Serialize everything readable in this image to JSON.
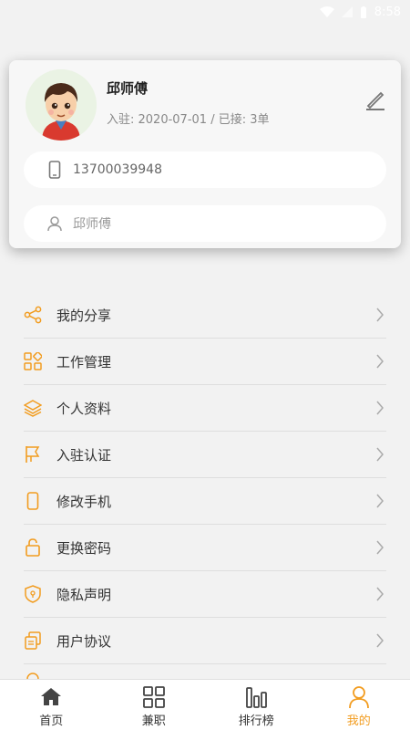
{
  "status_bar": {
    "time": "8:58"
  },
  "profile": {
    "name": "邱师傅",
    "meta": "入驻: 2020-07-01 / 已接: 3单",
    "phone": "13700039948",
    "name_field": "邱师傅"
  },
  "menu": {
    "items": [
      {
        "label": "我的分享",
        "icon": "share-icon"
      },
      {
        "label": "工作管理",
        "icon": "grid-icon"
      },
      {
        "label": "个人资料",
        "icon": "layers-icon"
      },
      {
        "label": "入驻认证",
        "icon": "flag-icon"
      },
      {
        "label": "修改手机",
        "icon": "mobile-icon"
      },
      {
        "label": "更换密码",
        "icon": "lock-icon"
      },
      {
        "label": "隐私声明",
        "icon": "shield-icon"
      },
      {
        "label": "用户协议",
        "icon": "document-icon"
      }
    ]
  },
  "tabbar": {
    "tabs": [
      {
        "label": "首页",
        "icon": "home-icon"
      },
      {
        "label": "兼职",
        "icon": "apps-icon"
      },
      {
        "label": "排行榜",
        "icon": "bar-chart-icon"
      },
      {
        "label": "我的",
        "icon": "user-icon",
        "active": true
      }
    ]
  },
  "colors": {
    "accent": "#f29c1f"
  }
}
